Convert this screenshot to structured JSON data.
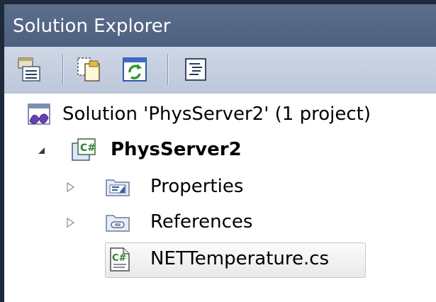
{
  "window": {
    "title": "Solution Explorer"
  },
  "toolbar": {
    "buttons": [
      {
        "name": "properties-icon"
      },
      {
        "name": "show-all-files-icon"
      },
      {
        "name": "refresh-icon"
      },
      {
        "name": "view-code-icon"
      }
    ]
  },
  "tree": {
    "solution": {
      "label": "Solution 'PhysServer2' (1 project)",
      "icon": "solution-icon"
    },
    "project": {
      "label": "PhysServer2",
      "icon": "csharp-project-icon",
      "expanded": true
    },
    "children": [
      {
        "label": "Properties",
        "icon": "properties-folder-icon",
        "expandable": true
      },
      {
        "label": "References",
        "icon": "references-folder-icon",
        "expandable": true
      },
      {
        "label": "NETTemperature.cs",
        "icon": "csharp-file-icon",
        "selected": true
      }
    ]
  },
  "colors": {
    "title_bar": "#4d6080",
    "toolbar": "#c6d0e2",
    "frame": "#1e2a3c",
    "selection": "#e9e9e9"
  }
}
